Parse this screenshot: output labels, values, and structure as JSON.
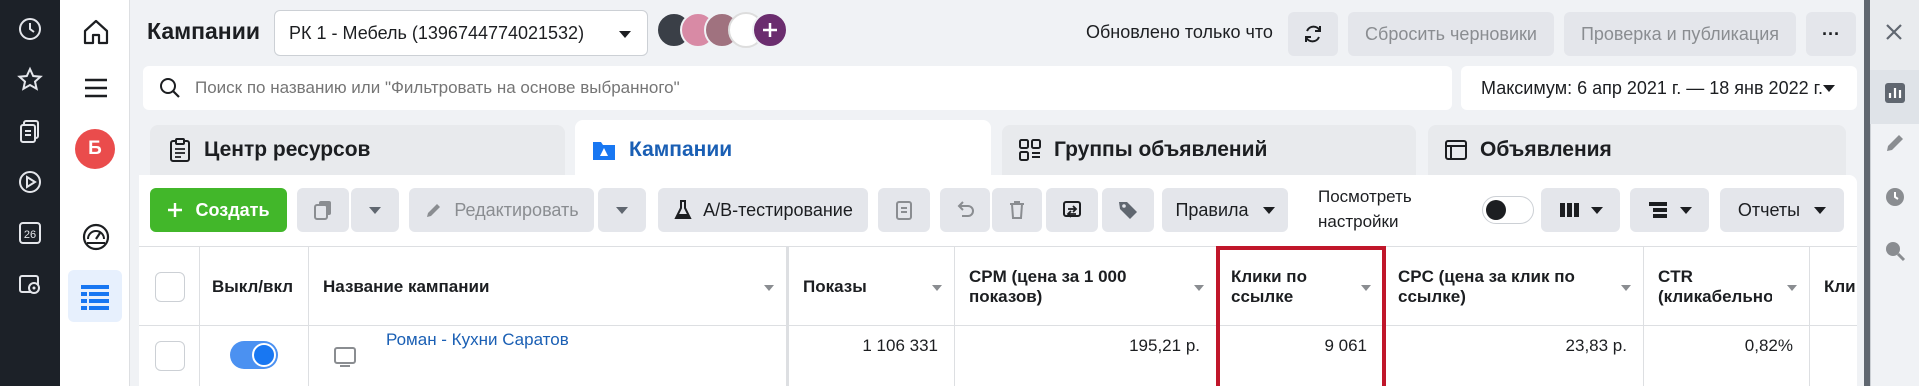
{
  "header": {
    "title": "Кампании",
    "campaign_select": "РК 1 - Мебель (1396744774021532)",
    "updated_text": "Обновлено только что",
    "reset_drafts": "Сбросить черновики",
    "review_publish": "Проверка и публикация",
    "more": "···"
  },
  "search": {
    "placeholder": "Поиск по названию или \"Фильтровать на основе выбранного\"",
    "date_range": "Максимум: 6 апр 2021 г. — 18 янв 2022 г."
  },
  "nav": {
    "avatar_letter": "Б"
  },
  "tabs": [
    {
      "label": "Центр ресурсов"
    },
    {
      "label": "Кампании"
    },
    {
      "label": "Группы объявлений"
    },
    {
      "label": "Объявления"
    }
  ],
  "toolbar": {
    "create": "Создать",
    "edit": "Редактировать",
    "ab_test": "A/B-тестирование",
    "rules": "Правила",
    "view_settings": "Посмотреть настройки",
    "reports": "Отчеты"
  },
  "table": {
    "headers": {
      "onoff": "Выкл/вкл",
      "name": "Название кампании",
      "impressions": "Показы",
      "cpm": "CPM (цена за 1 000 показов)",
      "link_clicks": "Клики по ссылке",
      "cpc": "CPC (цена за клик по ссылке)",
      "ctr": "CTR (кликабельность",
      "clicks": "Кли"
    },
    "rows": [
      {
        "name": "Роман - Кухни Саратов",
        "impressions": "1 106 331",
        "cpm": "195,21 р.",
        "link_clicks": "9 061",
        "cpc": "23,83 р.",
        "ctr": "0,82%"
      }
    ]
  },
  "colors": {
    "accent": "#1877f2",
    "create_green": "#42b72a",
    "highlight_red": "#c0162a"
  }
}
